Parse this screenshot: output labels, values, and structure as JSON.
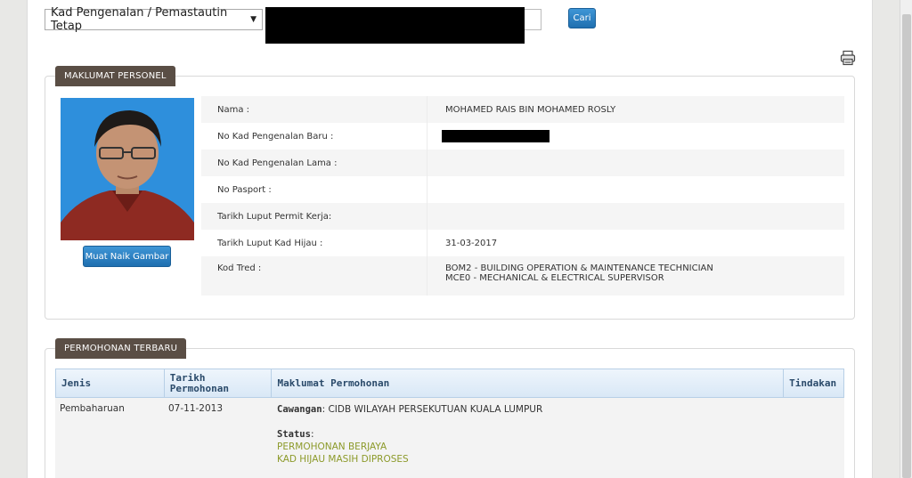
{
  "search": {
    "id_type": "Kad Pengenalan / Pemastautin Tetap",
    "search_label": "Cari"
  },
  "personel": {
    "section_title": "MAKLUMAT PERSONEL",
    "upload_label": "Muat Naik Gambar",
    "fields": [
      {
        "label": "Nama :",
        "value": "MOHAMED RAIS BIN MOHAMED ROSLY"
      },
      {
        "label": "No Kad Pengenalan Baru :",
        "value": ""
      },
      {
        "label": "No Kad Pengenalan Lama :",
        "value": ""
      },
      {
        "label": "No Pasport :",
        "value": ""
      },
      {
        "label": "Tarikh Luput Permit Kerja:",
        "value": ""
      },
      {
        "label": "Tarikh Luput Kad Hijau :",
        "value": "31-03-2017"
      },
      {
        "label": "Kod Tred :",
        "value": "BOM2 - BUILDING OPERATION & MAINTENANCE TECHNICIAN",
        "value2": "MCE0 - MECHANICAL & ELECTRICAL SUPERVISOR"
      }
    ]
  },
  "permohonan": {
    "section_title": "PERMOHONAN TERBARU",
    "headers": {
      "jenis": "Jenis",
      "tarikh_1": "Tarikh",
      "tarikh_2": "Permohonan",
      "maklumat": "Maklumat Permohonan",
      "tindakan": "Tindakan"
    },
    "rows": [
      {
        "jenis": "Pembaharuan",
        "tarikh": "07-11-2013",
        "cawangan_label": "Cawangan",
        "cawangan_value": ": CIDB WILAYAH PERSEKUTUAN KUALA LUMPUR",
        "status_label": "Status",
        "status_colon": ":",
        "status_1": "PERMOHONAN BERJAYA",
        "status_2": "KAD HIJAU MASIH DIPROSES"
      }
    ]
  },
  "colors": {
    "status_ok": "#8c9a2a",
    "tag_bg": "#5a4e45",
    "button_blue": "#2a7fc2"
  }
}
